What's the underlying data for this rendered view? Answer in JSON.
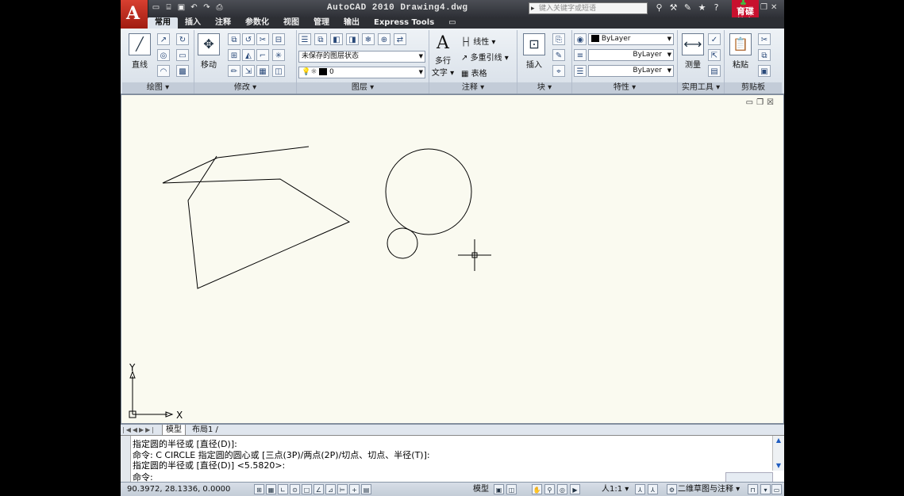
{
  "app": {
    "title": "AutoCAD 2010   Drawing4.dwg",
    "menu_button_letter": "A",
    "search_placeholder": "键入关键字或短语",
    "brand_logo_text": [
      "育碟",
      "教育"
    ]
  },
  "quick_access": [
    "new-icon",
    "open-icon",
    "save-icon",
    "undo-icon",
    "redo-icon",
    "plot-icon"
  ],
  "ribbon_tabs": [
    {
      "label": "常用",
      "active": true
    },
    {
      "label": "插入"
    },
    {
      "label": "注释"
    },
    {
      "label": "参数化"
    },
    {
      "label": "视图"
    },
    {
      "label": "管理"
    },
    {
      "label": "输出"
    },
    {
      "label": "Express Tools"
    }
  ],
  "panels": {
    "draw": {
      "title": "绘图 ▾",
      "line_label": "直线"
    },
    "modify": {
      "title": "修改 ▾",
      "move_label": "移动"
    },
    "layers": {
      "title": "图层 ▾",
      "state_value": "未保存的图层状态",
      "layer_value": "0"
    },
    "annotation": {
      "title": "注释 ▾",
      "mtext_label": "多行\n文字",
      "mtext_line1": "多行",
      "mtext_line2": "文字 ▾",
      "linear_label": "线性 ▾",
      "mleader_label": "多重引线 ▾",
      "table_label": "表格"
    },
    "block": {
      "title": "块 ▾",
      "insert_label": "插入"
    },
    "properties": {
      "title": "特性 ▾",
      "color": "ByLayer",
      "linetype": "ByLayer",
      "lineweight": "ByLayer"
    },
    "utilities": {
      "title": "实用工具 ▾",
      "measure_label": "测量"
    },
    "clipboard": {
      "title": "剪贴板",
      "paste_label": "粘贴"
    }
  },
  "layout_tabs": [
    {
      "label": "模型",
      "active": true
    },
    {
      "label": "布局1 /"
    }
  ],
  "command_history": [
    "指定圆的半径或 [直径(D)]:",
    "命令: C CIRCLE 指定圆的圆心或 [三点(3P)/两点(2P)/切点、切点、半径(T)]:",
    "指定圆的半径或 [直径(D)] <5.5820>:",
    "命令:"
  ],
  "status": {
    "coordinates": "90.3972, 28.1336, 0.0000",
    "model_label": "模型",
    "annotation_scale": "人1:1 ▾",
    "workspace": "二维草图与注释 ▾"
  },
  "ucs": {
    "x_label": "X",
    "y_label": "Y"
  },
  "colors": {
    "canvas": "#fafaf0",
    "title_bar": "#2e3036",
    "ribbon": "#dde4ec",
    "accent_red": "#c8102e"
  }
}
